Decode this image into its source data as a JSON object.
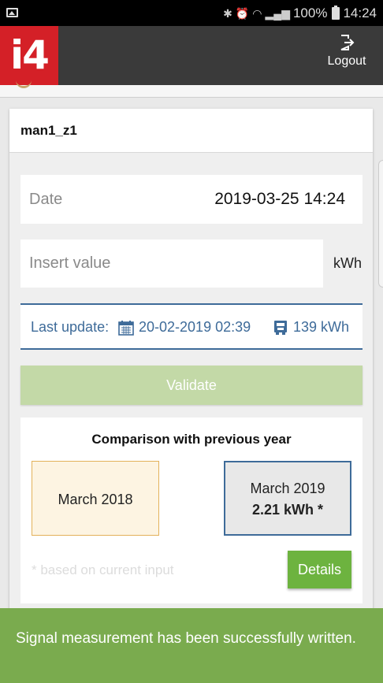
{
  "status_bar": {
    "battery": "100%",
    "time": "14:24"
  },
  "header": {
    "logo": "i4",
    "logout_label": "Logout"
  },
  "card": {
    "title": "man1_z1",
    "date_label": "Date",
    "date_value": "2019-03-25 14:24",
    "value_placeholder": "Insert value",
    "unit": "kWh",
    "last_update_label": "Last update:",
    "last_update_date": "20-02-2019 02:39",
    "last_update_value": "139 kWh",
    "validate_label": "Validate"
  },
  "comparison": {
    "title": "Comparison with previous year",
    "previous_label": "March 2018",
    "current_label": "March 2019",
    "current_value": "2.21 kWh *",
    "note": "* based on current input",
    "details_label": "Details"
  },
  "toast": {
    "message": "Signal measurement has been successfully written."
  },
  "colors": {
    "brand_red": "#d42027",
    "app_bar": "#3a3a3a",
    "accent_blue": "#3e6b99",
    "validate_disabled": "#c3d9a7",
    "details_green": "#6db33f",
    "toast_green": "#7aab4e"
  },
  "icons": [
    "image-icon",
    "bluetooth-icon",
    "alarm-icon",
    "wifi-icon",
    "signal-icon",
    "battery-icon",
    "logout-icon",
    "calendar-icon",
    "meter-icon"
  ]
}
